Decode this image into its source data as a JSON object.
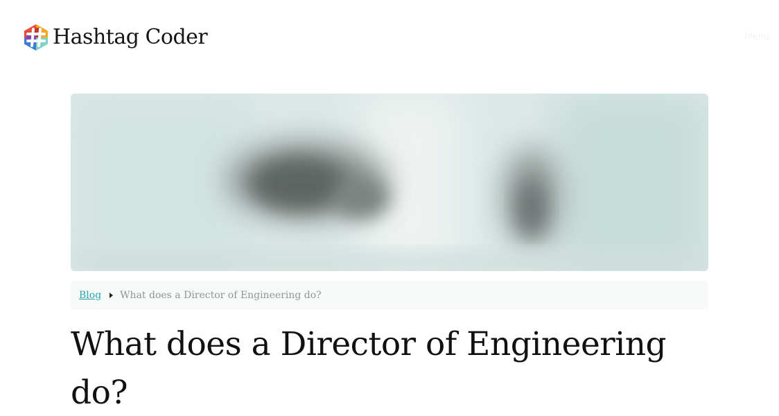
{
  "site": {
    "name": "Hashtag Coder",
    "menu_label": "Menu"
  },
  "breadcrumb": {
    "parent": "Blog",
    "current": "What does a Director of Engineering do?"
  },
  "article": {
    "title": "What does a Director of Engineering do?"
  },
  "colors": {
    "link": "#2aa3b1",
    "breadcrumb_bg": "#f8fafa",
    "hero_tint": "#c8dedb"
  },
  "icons": {
    "logo": "hashtag-logo-icon",
    "separator": "caret-right-icon"
  }
}
